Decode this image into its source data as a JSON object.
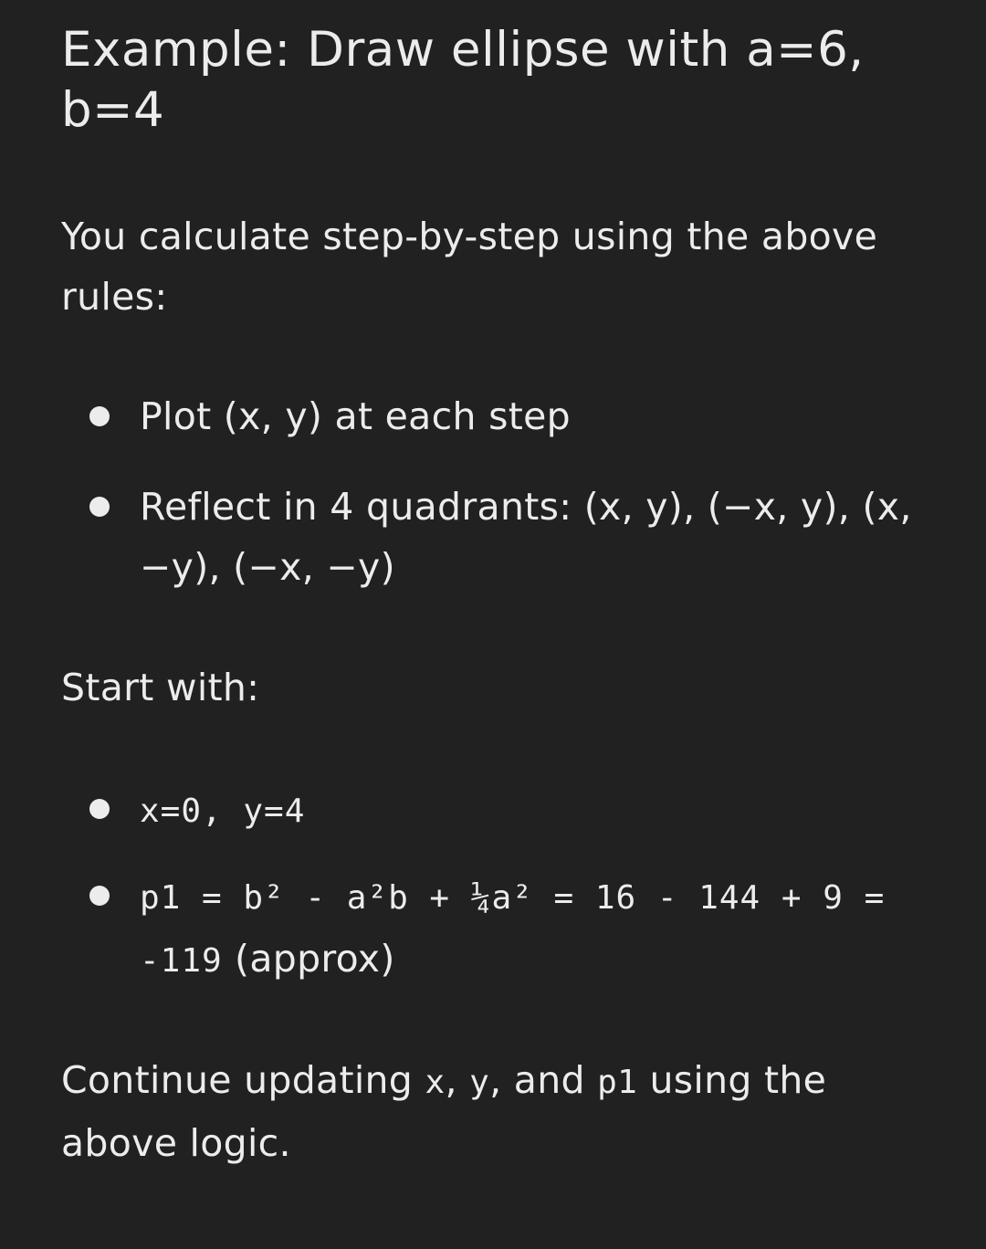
{
  "heading": "Example: Draw ellipse with a=6, b=4",
  "intro": "You calculate step-by-step using the above rules:",
  "bullets_plot": [
    "Plot (x, y) at each step",
    "Reflect in 4 quadrants: (x, y), (−x, y), (x, −y), (−x, −y)"
  ],
  "start_label": "Start with:",
  "start_values": {
    "init": "x=0, y=4",
    "p1_formula": "p1 = b² - a²b + ¼a² = 16 - 144 + 9 = -119",
    "p1_note": "(approx)"
  },
  "outro": {
    "before": "Continue updating ",
    "code1": "x",
    "sep1": ", ",
    "code2": "y",
    "sep2": ", and ",
    "code3": "p1",
    "after": " using the above logic."
  }
}
